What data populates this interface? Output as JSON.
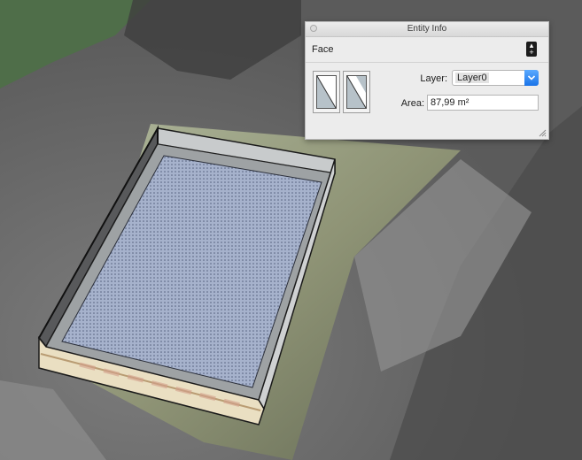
{
  "panel": {
    "title": "Entity Info",
    "entity_type": "Face",
    "layer_label": "Layer:",
    "layer_value": "Layer0",
    "area_label": "Area:",
    "area_value": "87,99 m²"
  },
  "icons": {
    "close": "close-icon",
    "details_toggle": "details-toggle-icon",
    "front_material": "front-face-material-swatch",
    "back_material": "back-face-material-swatch",
    "dropdown": "chevron-down-icon",
    "resize": "resize-grip-icon"
  },
  "colors": {
    "face_fill": "#9aa8c4",
    "wall_gray": "#9fa3a5",
    "wall_side_light": "#eadfc2",
    "accent_blue": "#1a73e8"
  }
}
